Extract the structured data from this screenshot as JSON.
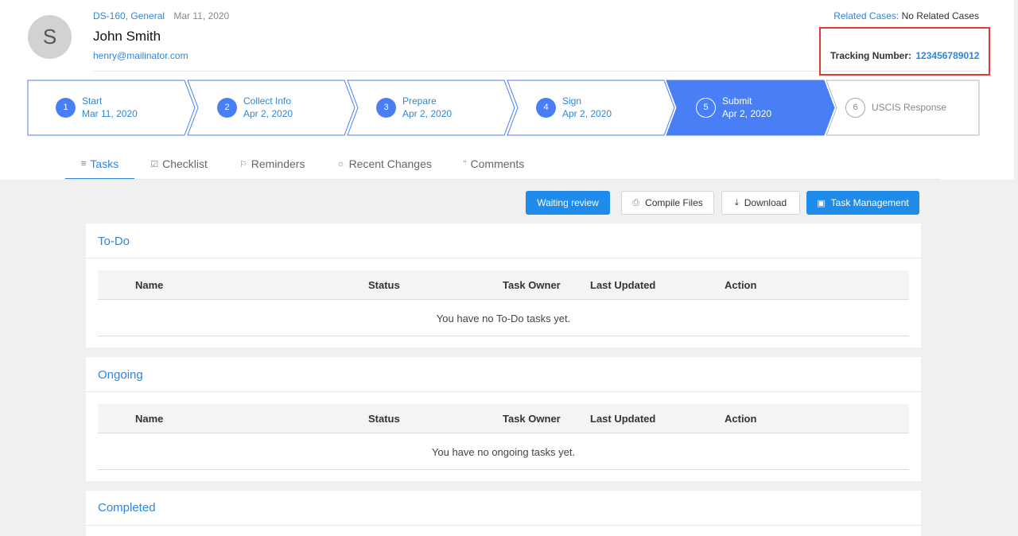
{
  "header": {
    "avatar_initial": "S",
    "case_type": "DS-160, General",
    "case_date": "Mar 11, 2020",
    "client_name": "John Smith",
    "client_email": "henry@mailinator.com",
    "related_label": "Related Cases:",
    "related_value": "No Related Cases",
    "tracking_label": "Tracking Number:",
    "tracking_number": "123456789012"
  },
  "steps": [
    {
      "num": "1",
      "title": "Start",
      "date": "Mar 11, 2020",
      "state": "done"
    },
    {
      "num": "2",
      "title": "Collect Info",
      "date": "Apr 2, 2020",
      "state": "done"
    },
    {
      "num": "3",
      "title": "Prepare",
      "date": "Apr 2, 2020",
      "state": "done"
    },
    {
      "num": "4",
      "title": "Sign",
      "date": "Apr 2, 2020",
      "state": "done"
    },
    {
      "num": "5",
      "title": "Submit",
      "date": "Apr 2, 2020",
      "state": "active"
    },
    {
      "num": "6",
      "title": "USCIS Response",
      "date": "",
      "state": "pending"
    }
  ],
  "tabs": [
    {
      "label": "Tasks",
      "icon": "list-icon"
    },
    {
      "label": "Checklist",
      "icon": "checkbox-icon"
    },
    {
      "label": "Reminders",
      "icon": "bell-icon"
    },
    {
      "label": "Recent Changes",
      "icon": "lightbulb-icon"
    },
    {
      "label": "Comments",
      "icon": "quote-icon"
    }
  ],
  "toolbar": {
    "waiting_review": "Waiting review",
    "compile_files": "Compile Files",
    "download": "Download",
    "task_management": "Task Management"
  },
  "columns": [
    "Name",
    "Status",
    "Task Owner",
    "Last Updated",
    "Action"
  ],
  "panels": {
    "todo": {
      "title": "To-Do",
      "empty": "You have no To-Do tasks yet."
    },
    "ongoing": {
      "title": "Ongoing",
      "empty": "You have no ongoing tasks yet."
    },
    "completed": {
      "title": "Completed"
    }
  },
  "colors": {
    "accent": "#2f87d8",
    "active_step": "#4a7ef5",
    "highlight_border": "#e53935"
  }
}
